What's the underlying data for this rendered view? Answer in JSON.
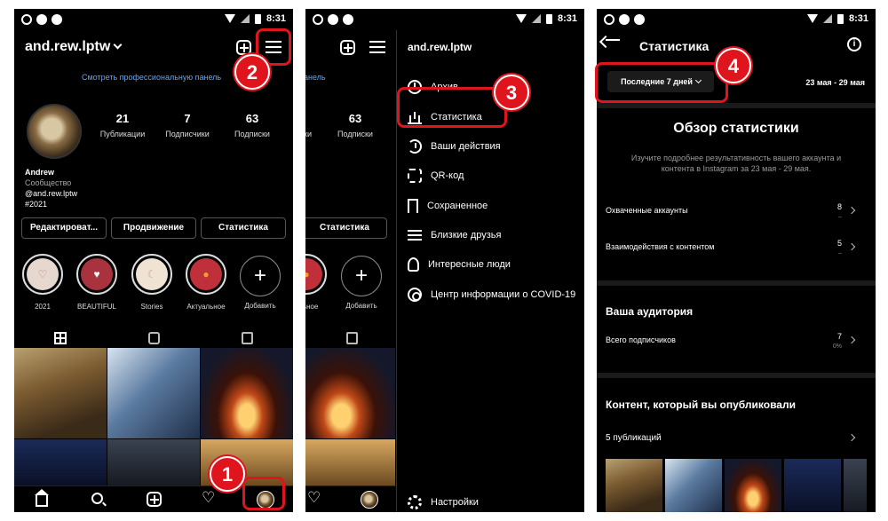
{
  "status_bar": {
    "time": "8:31"
  },
  "profile": {
    "username": "and.rew.lptw",
    "pro_dashboard_link": "Смотреть профессиональную панель",
    "stats": [
      {
        "value": "21",
        "label": "Публикации"
      },
      {
        "value": "7",
        "label": "Подписчики"
      },
      {
        "value": "63",
        "label": "Подписки"
      }
    ],
    "bio": {
      "name": "Andrew",
      "category": "Сообщество",
      "handle": "@and.rew.lptw",
      "tag": "#2021"
    },
    "buttons": {
      "edit": "Редактироват...",
      "promote": "Продвижение",
      "insights": "Статистика"
    },
    "highlights": [
      {
        "label": "2021",
        "glyph": "♡",
        "color": "#e6d8cf"
      },
      {
        "label": "BEAUTIFUL",
        "glyph": "♥",
        "color": "#a8333f"
      },
      {
        "label": "Stories",
        "glyph": "☾",
        "color": "#efe4d4"
      },
      {
        "label": "Актуальное",
        "glyph": "●",
        "color": "#c0303a"
      }
    ],
    "add_highlight": "Добавить"
  },
  "side_menu": {
    "username": "and.rew.lptw",
    "items": [
      {
        "label": "Архив",
        "icon": "archive-icon"
      },
      {
        "label": "Статистика",
        "icon": "insights-chart-icon"
      },
      {
        "label": "Ваши действия",
        "icon": "activity-clock-icon"
      },
      {
        "label": "QR-код",
        "icon": "qr-code-icon"
      },
      {
        "label": "Сохраненное",
        "icon": "bookmark-icon"
      },
      {
        "label": "Близкие друзья",
        "icon": "close-friends-list-icon"
      },
      {
        "label": "Интересные люди",
        "icon": "add-person-icon"
      },
      {
        "label": "Центр информации о COVID-19",
        "icon": "covid-info-icon"
      }
    ],
    "settings": "Настройки"
  },
  "insights": {
    "title": "Статистика",
    "period": "Последние 7 дней",
    "date_range": "23 мая - 29 мая",
    "overview_title": "Обзор статистики",
    "overview_desc": "Изучите подробнее результативность вашего аккаунта и контента в Instagram за 23 мая - 29 мая.",
    "metrics": [
      {
        "label": "Охваченные аккаунты",
        "value": "8",
        "sub": "–"
      },
      {
        "label": "Взаимодействия с контентом",
        "value": "5",
        "sub": "–"
      }
    ],
    "audience_title": "Ваша аудитория",
    "followers_label": "Всего подписчиков",
    "followers_value": "7",
    "followers_sub": "0%",
    "content_title": "Контент, который вы опубликовали",
    "posts_count": "5 публикаций"
  },
  "annotations": [
    "1",
    "2",
    "3",
    "4"
  ],
  "colors": {
    "highlight": "#e0141c",
    "link": "#5aa6ff",
    "background": "#000000"
  }
}
